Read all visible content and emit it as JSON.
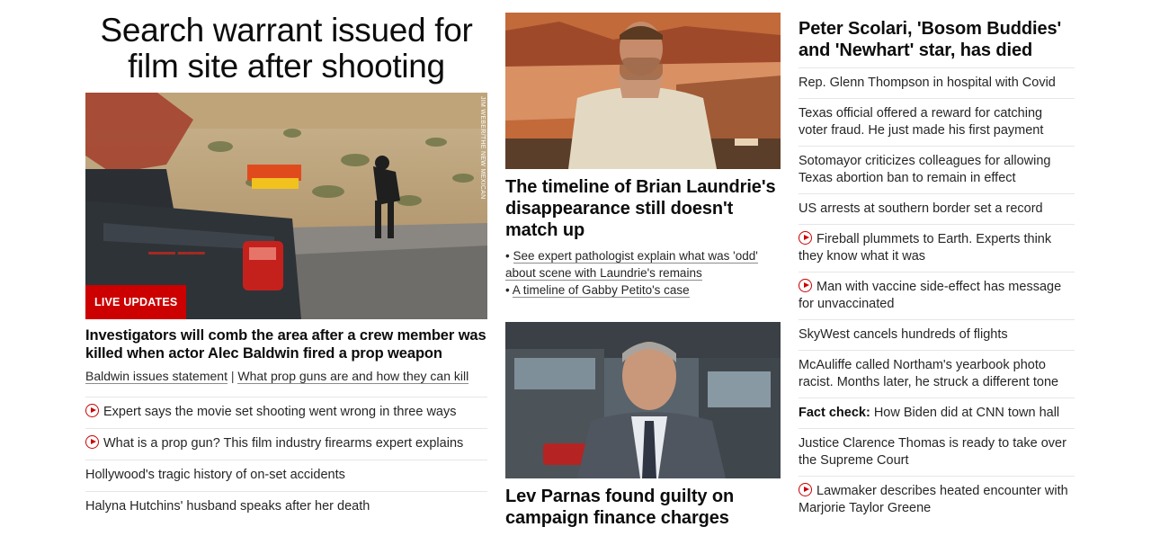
{
  "col1": {
    "headline": "Search warrant issued for film site after shooting",
    "image_credit": "JIM WEBER/THE NEW MEXICAN",
    "badge": "LIVE UPDATES",
    "lead_title": "Investigators will comb the area after a crew member was killed when actor Alec Baldwin fired a prop weapon",
    "related_1": "Baldwin issues statement",
    "related_sep": "|",
    "related_2": "What prop guns are and how they can kill",
    "list": [
      {
        "text": "Expert says the movie set shooting went wrong in three ways",
        "video": true
      },
      {
        "text": "What is a prop gun? This film industry firearms expert explains",
        "video": true
      },
      {
        "text": "Hollywood's tragic history of on-set accidents",
        "video": false
      },
      {
        "text": "Halyna Hutchins' husband speaks after her death",
        "video": false
      }
    ]
  },
  "col2": {
    "story1_title": "The timeline of Brian Laundrie's disappearance still doesn't match up",
    "bullet_1": "See expert pathologist explain what was 'odd' about scene with Laundrie's remains",
    "bullet_2": "A timeline of Gabby Petito's case",
    "bullet_mark": "•",
    "story2_title": "Lev Parnas found guilty on campaign finance charges"
  },
  "col3": {
    "headline": "Peter Scolari, 'Bosom Buddies' and 'Newhart' star, has died",
    "list": [
      {
        "text": "Rep. Glenn Thompson in hospital with Covid",
        "video": false
      },
      {
        "text": "Texas official offered a reward for catching voter fraud. He just made his first payment",
        "video": false
      },
      {
        "text": "Sotomayor criticizes colleagues for allowing Texas abortion ban to remain in effect",
        "video": false
      },
      {
        "text": "US arrests at southern border set a record",
        "video": false
      },
      {
        "text": "Fireball plummets to Earth. Experts think they know what it was",
        "video": true
      },
      {
        "text": "Man with vaccine side-effect has message for unvaccinated",
        "video": true
      },
      {
        "text": "SkyWest cancels hundreds of flights",
        "video": false
      },
      {
        "text": "McAuliffe called Northam's yearbook photo racist. Months later, he struck a different tone",
        "video": false
      },
      {
        "prefix": "Fact check:",
        "text": "How Biden did at CNN town hall",
        "video": false
      },
      {
        "text": "Justice Clarence Thomas is ready to take over the Supreme Court",
        "video": false
      },
      {
        "text": "Lawmaker describes heated encounter with Marjorie Taylor Greene",
        "video": true
      }
    ]
  },
  "colors": {
    "accent": "#cc0000",
    "divider": "#e6e6e6",
    "text": "#0c0c0c"
  },
  "icons": {
    "video": "play-circle-icon"
  }
}
